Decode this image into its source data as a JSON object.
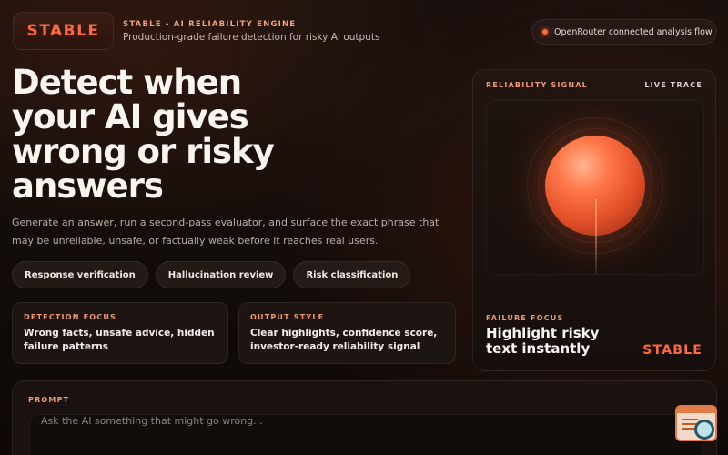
{
  "brand": {
    "logo": "STABLE",
    "tagline": "STABLE - AI RELIABILITY ENGINE",
    "subtitle": "Production-grade failure detection for risky AI outputs"
  },
  "status": {
    "text": "OpenRouter connected analysis flow",
    "accent": "#ff6a3d"
  },
  "hero": {
    "title": "Detect when your AI gives wrong or risky answers",
    "description": "Generate an answer, run a second-pass evaluator, and surface the exact phrase that may be unreliable, unsafe, or factually weak before it reaches real users."
  },
  "chips": [
    "Response verification",
    "Hallucination review",
    "Risk classification"
  ],
  "cards": [
    {
      "label": "DETECTION FOCUS",
      "text": "Wrong facts, unsafe advice, hidden failure patterns"
    },
    {
      "label": "OUTPUT STYLE",
      "text": "Clear highlights, confidence score, investor-ready reliability signal"
    }
  ],
  "signal": {
    "label": "RELIABILITY SIGNAL",
    "trace": "LIVE TRACE",
    "failure_label": "FAILURE FOCUS",
    "failure_text": "Highlight risky text instantly",
    "logo": "STABLE"
  },
  "prompt": {
    "label": "PROMPT",
    "placeholder": "Ask the AI something that might go wrong..."
  },
  "floating_button": {
    "icon": "search-document-icon"
  }
}
